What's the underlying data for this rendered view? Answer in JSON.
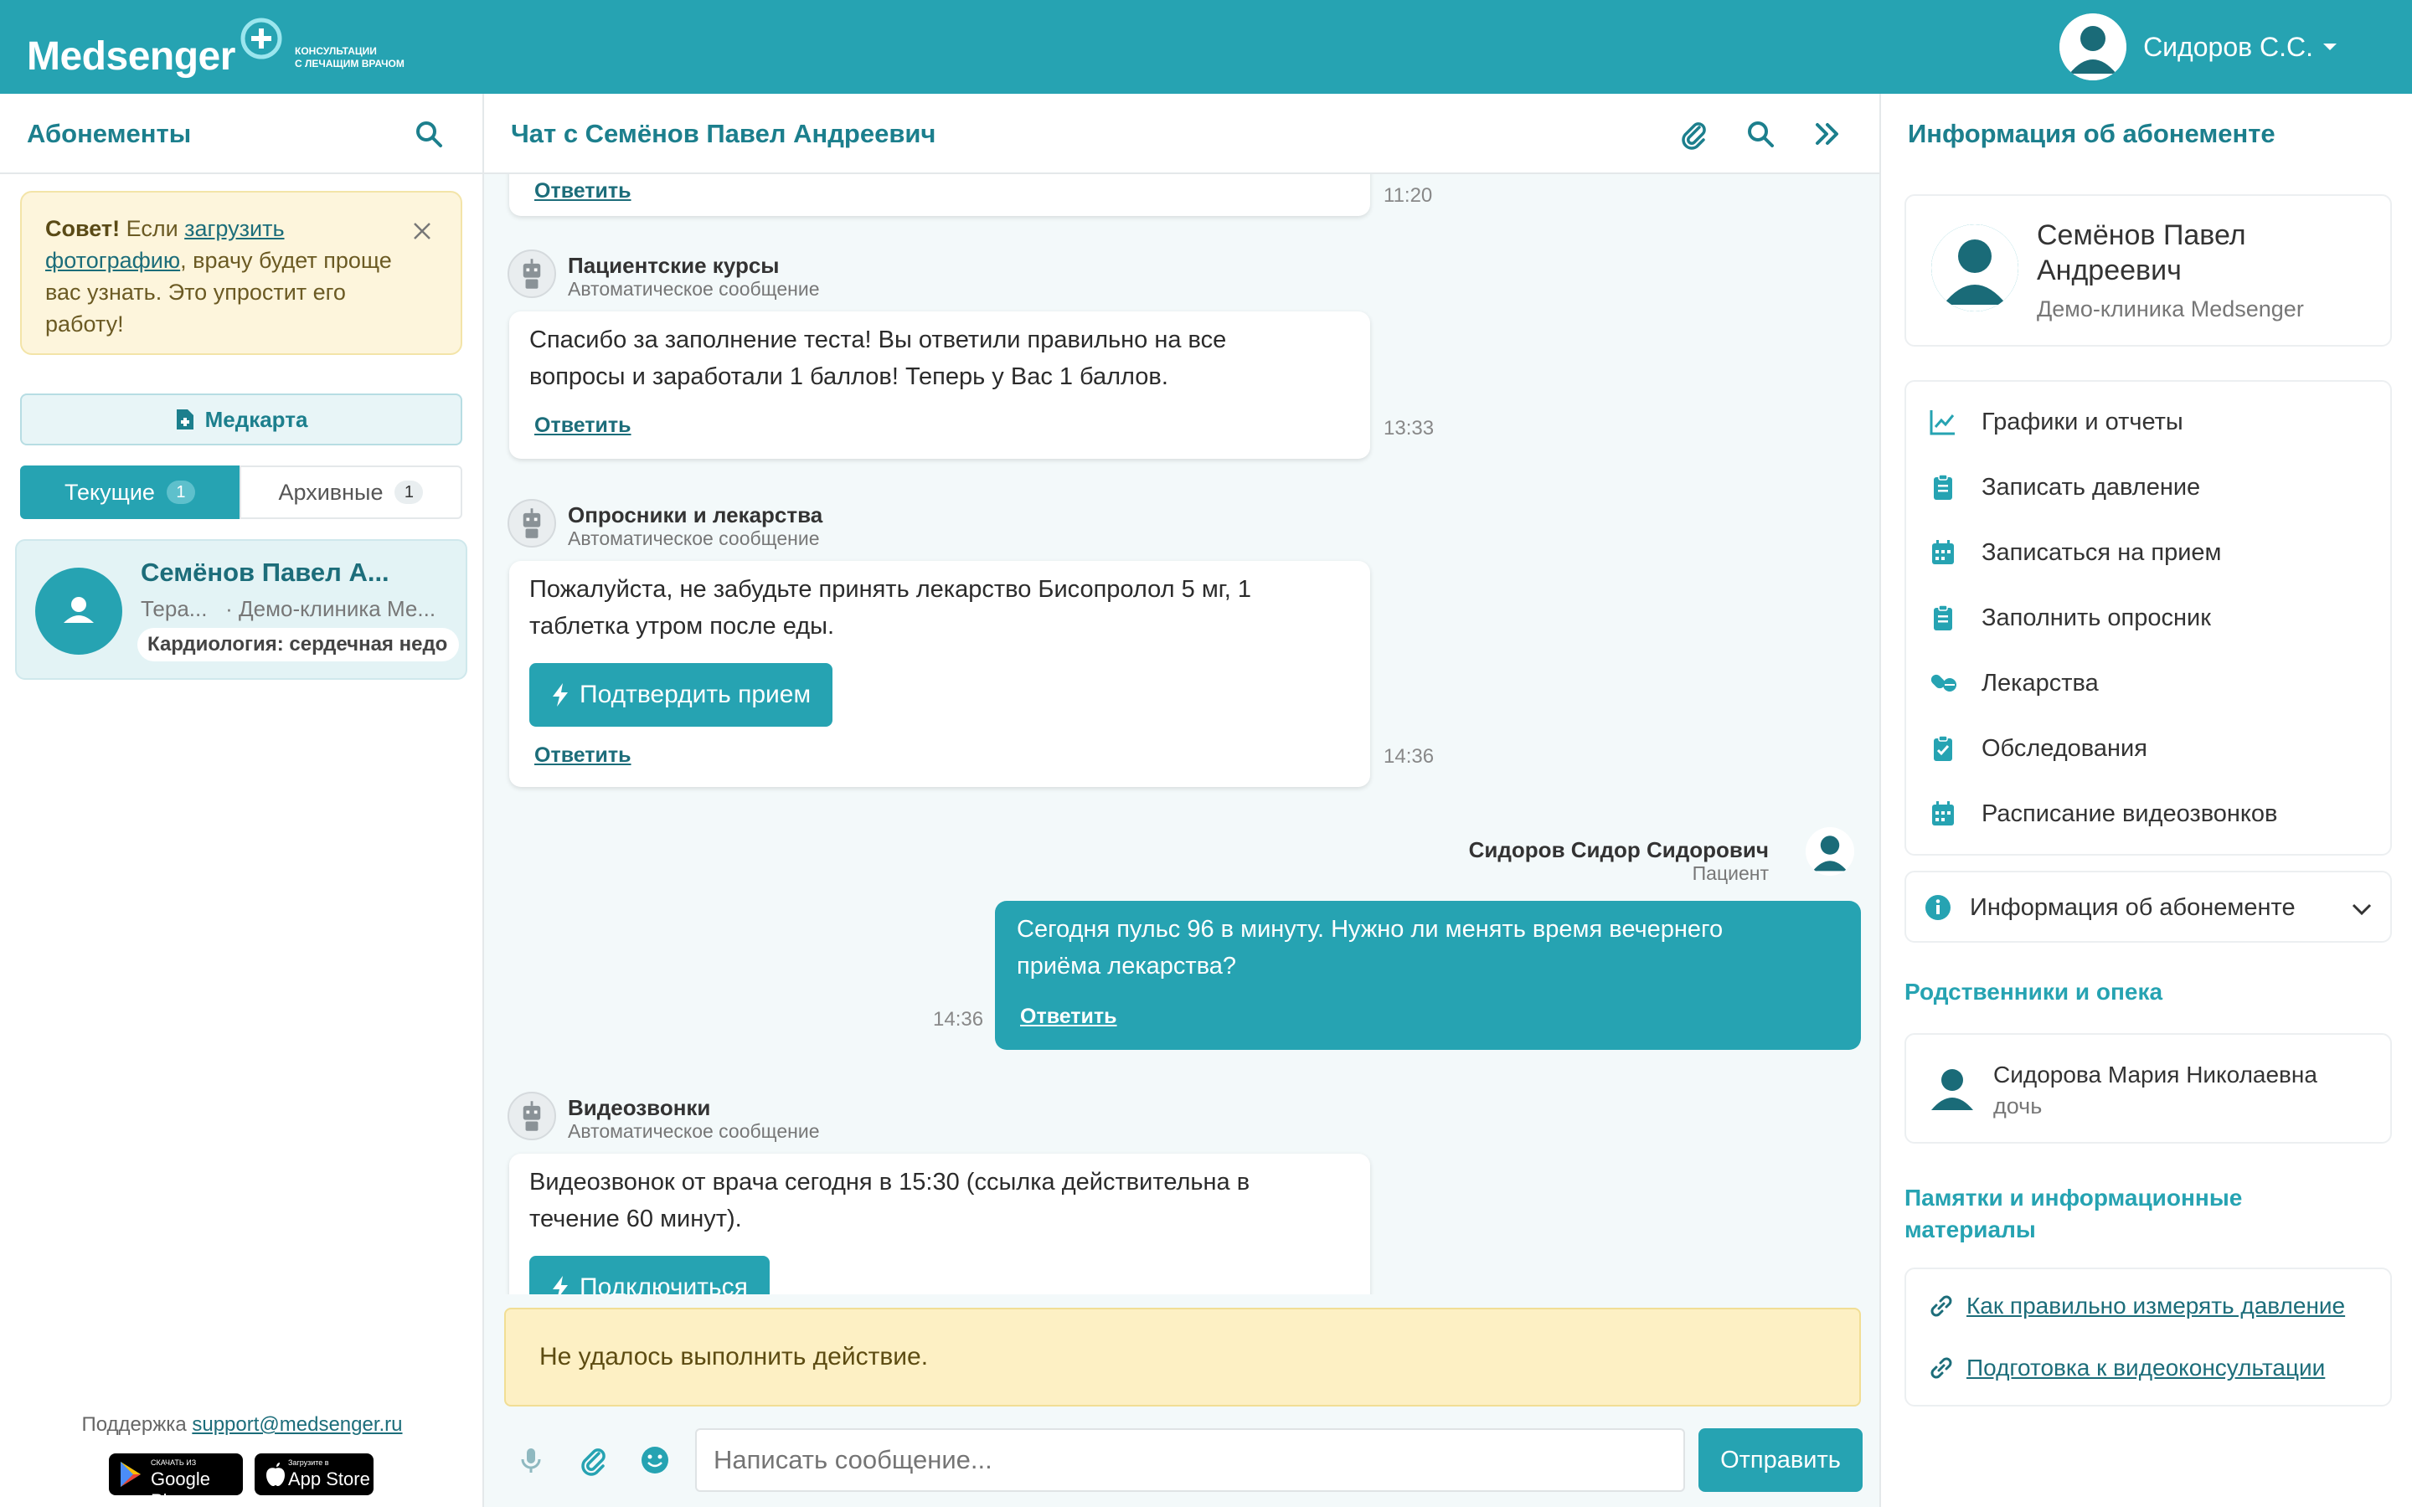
{
  "app": {
    "logo_main": "Medsenger",
    "logo_sub_1": "КОНСУЛЬТАЦИИ",
    "logo_sub_2": "С ЛЕЧАЩИМ ВРАЧОМ",
    "user_name": "Сидоров С.С.",
    "accent_color": "#26a3b2"
  },
  "left": {
    "title": "Абонементы",
    "tip_bold": "Совет!",
    "tip_pre": " Если ",
    "tip_link": "загрузить фотографию",
    "tip_post": ", врачу будет проще вас узнать. Это упростит его работу!",
    "medcard_label": "Медкарта",
    "tab_current": "Текущие",
    "tab_current_count": "1",
    "tab_archive": "Архивные",
    "tab_archive_count": "1",
    "sub_name": "Семёнов Павел А...",
    "sub_role": "Тера...",
    "sub_clinic": "· Демо-клиника Ме...",
    "sub_tag": "Кардиология: сердечная недо",
    "support_label": "Поддержка",
    "support_email": "support@medsenger.ru",
    "gp_small": "СКАЧАТЬ ИЗ",
    "gp_big": "Google Play",
    "as_small": "Загрузите в",
    "as_big": "App Store"
  },
  "chat": {
    "title": "Чат с Семёнов Павел Андреевич",
    "messages": [
      {
        "reply": "Ответить",
        "time": "11:20"
      },
      {
        "sender": "Пациентские курсы",
        "sub": "Автоматическое сообщение",
        "line1": "Спасибо за заполнение теста! Вы ответили правильно на все",
        "line2": "вопросы и заработали 1 баллов! Теперь у Вас 1 баллов.",
        "reply": "Ответить",
        "time": "13:33"
      },
      {
        "sender": "Опросники и лекарства",
        "sub": "Автоматическое сообщение",
        "line1": "Пожалуйста, не забудьте принять лекарство Бисопролол 5 мг, 1",
        "line2": "таблетка утром после еды.",
        "action": "Подтвердить прием",
        "reply": "Ответить",
        "time": "14:36"
      },
      {
        "sender": "Сидоров Сидор Сидорович",
        "sub": "Пациент",
        "line1": "Сегодня пульс 96 в минуту. Нужно ли менять время вечернего",
        "line2": "приёма лекарства?",
        "reply": "Ответить",
        "time": "14:36"
      },
      {
        "sender": "Видеозвонки",
        "sub": "Автоматическое сообщение",
        "line1": "Видеозвонок от врача сегодня в 15:30 (ссылка действительна в",
        "line2": "течение 60 минут).",
        "action": "Подключиться"
      }
    ],
    "alert": "Не удалось выполнить действие.",
    "input_placeholder": "Написать сообщение...",
    "send_label": "Отправить"
  },
  "right": {
    "title": "Информация об абонементе",
    "patient_name_1": "Семёнов Павел",
    "patient_name_2": "Андреевич",
    "clinic": "Демо-клиника Medsenger",
    "menu": [
      {
        "label": "Графики и отчеты",
        "icon": "chart-icon"
      },
      {
        "label": "Записать давление",
        "icon": "clipboard-icon"
      },
      {
        "label": "Записаться на прием",
        "icon": "calendar-icon"
      },
      {
        "label": "Заполнить опросник",
        "icon": "clipboard-icon"
      },
      {
        "label": "Лекарства",
        "icon": "pills-icon"
      },
      {
        "label": "Обследования",
        "icon": "clipboard-check-icon"
      },
      {
        "label": "Расписание видеозвонков",
        "icon": "calendar-icon"
      }
    ],
    "info_label": "Информация об абонементе",
    "relatives_title": "Родственники и опека",
    "relative_name": "Сидорова Мария Николаевна",
    "relative_role": "дочь",
    "materials_title_1": "Памятки и информационные",
    "materials_title_2": "материалы",
    "links": [
      "Как правильно измерять давление",
      "Подготовка к видеоконсультации"
    ]
  }
}
